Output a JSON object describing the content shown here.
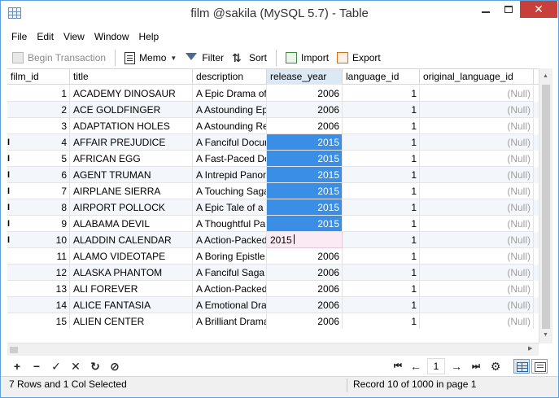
{
  "window": {
    "title": "film @sakila (MySQL 5.7) - Table",
    "close_glyph": "✕"
  },
  "menu": [
    "File",
    "Edit",
    "View",
    "Window",
    "Help"
  ],
  "toolbar": {
    "begin_transaction": "Begin Transaction",
    "memo": "Memo",
    "filter": "Filter",
    "sort": "Sort",
    "import": "Import",
    "export": "Export"
  },
  "columns": [
    "film_id",
    "title",
    "description",
    "release_year",
    "language_id",
    "original_language_id",
    ""
  ],
  "rows": [
    {
      "film_id": "1",
      "title": "ACADEMY DINOSAUR",
      "description": "A Epic Drama of",
      "release_year": "2006",
      "language_id": "1",
      "original_language_id": "(Null)"
    },
    {
      "film_id": "2",
      "title": "ACE GOLDFINGER",
      "description": "A Astounding Ep",
      "release_year": "2006",
      "language_id": "1",
      "original_language_id": "(Null)"
    },
    {
      "film_id": "3",
      "title": "ADAPTATION HOLES",
      "description": "A Astounding Re",
      "release_year": "2006",
      "language_id": "1",
      "original_language_id": "(Null)"
    },
    {
      "film_id": "4",
      "title": "AFFAIR PREJUDICE",
      "description": "A Fanciful Docur",
      "release_year": "2015",
      "language_id": "1",
      "original_language_id": "(Null)"
    },
    {
      "film_id": "5",
      "title": "AFRICAN EGG",
      "description": "A Fast-Paced Do",
      "release_year": "2015",
      "language_id": "1",
      "original_language_id": "(Null)"
    },
    {
      "film_id": "6",
      "title": "AGENT TRUMAN",
      "description": "A Intrepid Panor",
      "release_year": "2015",
      "language_id": "1",
      "original_language_id": "(Null)"
    },
    {
      "film_id": "7",
      "title": "AIRPLANE SIERRA",
      "description": "A Touching Saga",
      "release_year": "2015",
      "language_id": "1",
      "original_language_id": "(Null)"
    },
    {
      "film_id": "8",
      "title": "AIRPORT POLLOCK",
      "description": "A Epic Tale of a M",
      "release_year": "2015",
      "language_id": "1",
      "original_language_id": "(Null)"
    },
    {
      "film_id": "9",
      "title": "ALABAMA DEVIL",
      "description": "A Thoughtful Pa",
      "release_year": "2015",
      "language_id": "1",
      "original_language_id": "(Null)"
    },
    {
      "film_id": "10",
      "title": "ALADDIN CALENDAR",
      "description": "A Action-Packed",
      "release_year": "2015",
      "language_id": "1",
      "original_language_id": "(Null)"
    },
    {
      "film_id": "11",
      "title": "ALAMO VIDEOTAPE",
      "description": "A Boring Epistle",
      "release_year": "2006",
      "language_id": "1",
      "original_language_id": "(Null)"
    },
    {
      "film_id": "12",
      "title": "ALASKA PHANTOM",
      "description": "A Fanciful Saga o",
      "release_year": "2006",
      "language_id": "1",
      "original_language_id": "(Null)"
    },
    {
      "film_id": "13",
      "title": "ALI FOREVER",
      "description": "A Action-Packed",
      "release_year": "2006",
      "language_id": "1",
      "original_language_id": "(Null)"
    },
    {
      "film_id": "14",
      "title": "ALICE FANTASIA",
      "description": "A Emotional Dra",
      "release_year": "2006",
      "language_id": "1",
      "original_language_id": "(Null)"
    },
    {
      "film_id": "15",
      "title": "ALIEN CENTER",
      "description": "A Brilliant Drama",
      "release_year": "2006",
      "language_id": "1",
      "original_language_id": "(Null)"
    }
  ],
  "selection": {
    "rows": [
      4,
      5,
      6,
      7,
      8,
      9
    ],
    "column": "release_year",
    "editing_row": 10
  },
  "row_markers": [
    4,
    5,
    6,
    7,
    8,
    9,
    10
  ],
  "row_marker_glyph": "I",
  "bottom_toolbar": {
    "add": "+",
    "remove": "−",
    "apply": "✓",
    "cancel": "✕",
    "refresh": "↻",
    "stop": "⊘",
    "first": "⏮",
    "prev": "←",
    "page": "1",
    "next": "→",
    "last": "⏭",
    "settings": "⚙"
  },
  "status": {
    "left": "7 Rows and 1 Col Selected",
    "right": "Record 10 of 1000 in page 1"
  },
  "colors": {
    "selection": "#3a8ee6",
    "editing": "#fbeaf3",
    "null_text": "#a0a0a0",
    "close_button": "#c7403a"
  }
}
